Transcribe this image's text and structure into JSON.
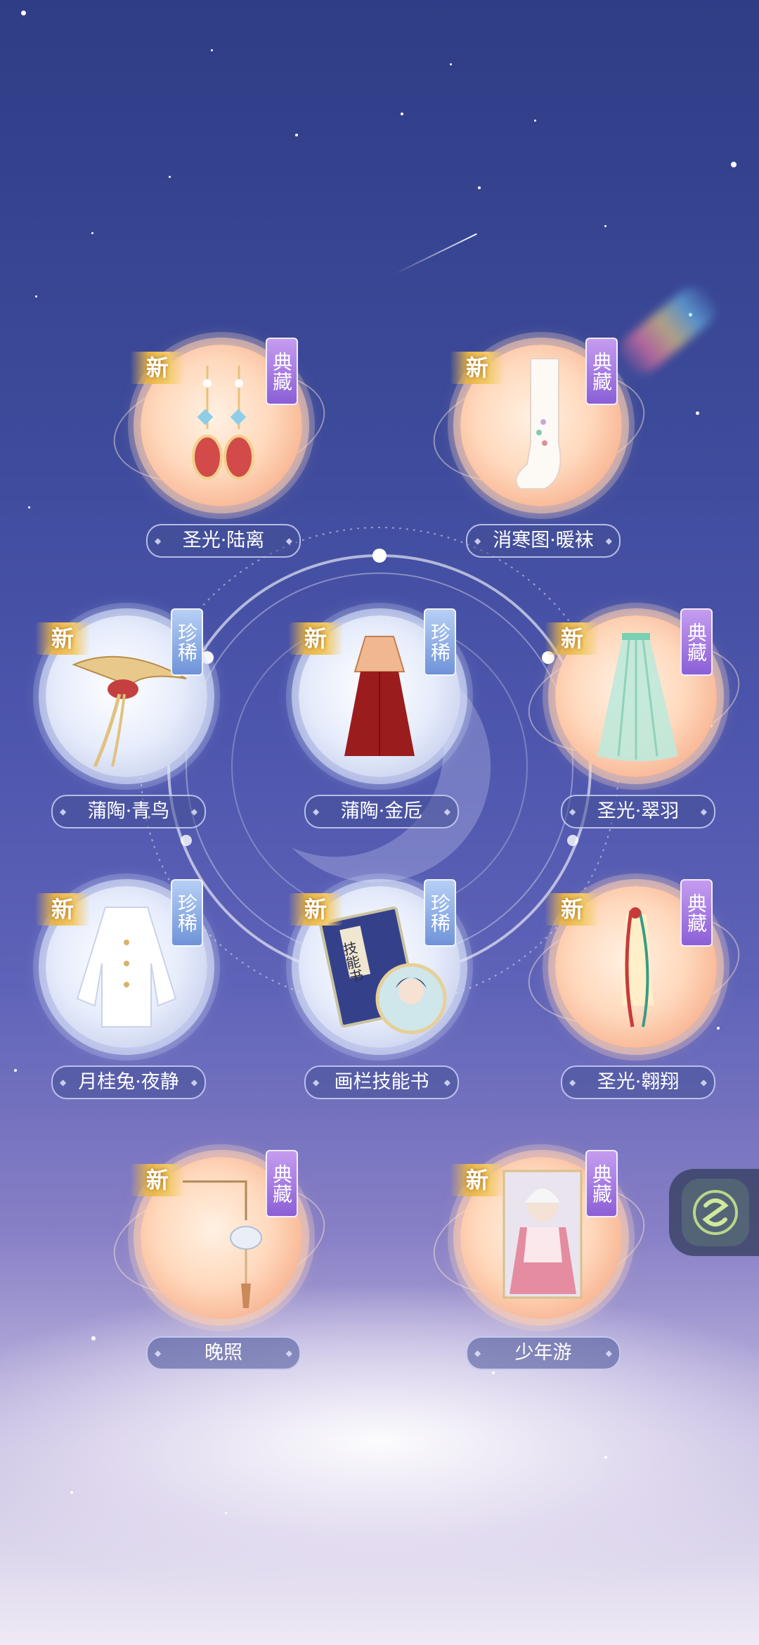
{
  "items": [
    {
      "id": "earrings",
      "name": "圣光·陆离",
      "new": "新",
      "rank": "典藏",
      "tier": "gold"
    },
    {
      "id": "socks",
      "name": "消寒图·暖袜",
      "new": "新",
      "rank": "典藏",
      "tier": "gold"
    },
    {
      "id": "bird",
      "name": "蒲陶·青鸟",
      "new": "新",
      "rank": "珍稀",
      "tier": "silver"
    },
    {
      "id": "dress",
      "name": "蒲陶·金卮",
      "new": "新",
      "rank": "珍稀",
      "tier": "silver"
    },
    {
      "id": "veil",
      "name": "圣光·翠羽",
      "new": "新",
      "rank": "典藏",
      "tier": "gold"
    },
    {
      "id": "jacket",
      "name": "月桂兔·夜静",
      "new": "新",
      "rank": "珍稀",
      "tier": "silver"
    },
    {
      "id": "book",
      "name": "画栏技能书",
      "new": "新",
      "rank": "珍稀",
      "tier": "silver",
      "book_title": "技能书"
    },
    {
      "id": "ribbon",
      "name": "圣光·翱翔",
      "new": "新",
      "rank": "典藏",
      "tier": "gold"
    },
    {
      "id": "lantern",
      "name": "晚照",
      "new": "新",
      "rank": "典藏",
      "tier": "gold"
    },
    {
      "id": "card",
      "name": "少年游",
      "new": "新",
      "rank": "典藏",
      "tier": "gold"
    }
  ],
  "side_button": {
    "icon": "swirl-s-icon"
  },
  "colors": {
    "gold_disc": "#ffd9bd",
    "silver_disc": "#e6ecfb",
    "rank_purple": "#8b5fd6",
    "rank_blue": "#6f93d8"
  }
}
